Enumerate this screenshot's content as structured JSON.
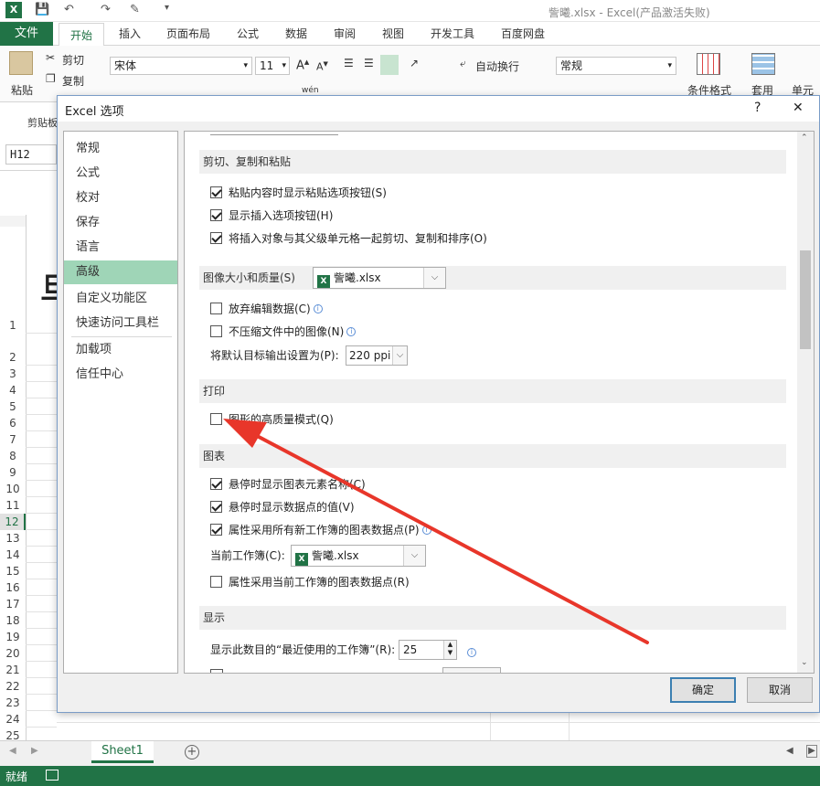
{
  "titlebar": {
    "title": "訾曦.xlsx - Excel(产品激活失败)"
  },
  "ribbon_tabs": {
    "file": "文件",
    "tabs": [
      "开始",
      "插入",
      "页面布局",
      "公式",
      "数据",
      "审阅",
      "视图",
      "开发工具",
      "百度网盘"
    ]
  },
  "ribbon": {
    "paste": "粘贴",
    "cut": "剪切",
    "copy": "复制",
    "clipboard": "剪贴板",
    "font_name": "宋体",
    "font_size": "11",
    "wrap_text": "自动换行",
    "number_format": "常规",
    "cond_format": "条件格式",
    "apply": "套用",
    "cell": "单元格",
    "wen": "wén"
  },
  "namebox": "H12",
  "rows": [
    "1",
    "2",
    "3",
    "4",
    "5",
    "6",
    "7",
    "8",
    "9",
    "10",
    "11",
    "12",
    "13",
    "14",
    "15",
    "16",
    "17",
    "18",
    "19",
    "20",
    "21",
    "22",
    "23",
    "24",
    "25"
  ],
  "sheet_tab": "Sheet1",
  "status": "就绪",
  "dialog": {
    "title": "Excel 选项",
    "help": "?",
    "close": "✕",
    "nav": [
      "常规",
      "公式",
      "校对",
      "保存",
      "语言",
      "高级",
      "自定义功能区",
      "快速访问工具栏",
      "加载项",
      "信任中心"
    ],
    "sections": {
      "cut_copy": "剪切、复制和粘贴",
      "image": "图像大小和质量(S)",
      "print": "打印",
      "chart": "图表",
      "display": "显示"
    },
    "options": {
      "paste_btn": "粘贴内容时显示粘贴选项按钮(S)",
      "insert_btn": "显示插入选项按钮(H)",
      "cut_sort": "将插入对象与其父级单元格一起剪切、复制和排序(O)",
      "discard_edit": "放弃编辑数据(C)",
      "no_compress": "不压缩文件中的图像(N)",
      "default_res": "将默认目标输出设置为(P):",
      "hq_graphics": "图形的高质量模式(Q)",
      "hover_name": "悬停时显示图表元素名称(C)",
      "hover_value": "悬停时显示数据点的值(V)",
      "props_follow_new": "属性采用所有新工作簿的图表数据点(P)",
      "current_wb": "当前工作簿(C):",
      "props_follow_current": "属性采用当前工作簿的图表数据点(R)",
      "recent_count": "显示此数目的“最近使用的工作簿”(R):"
    },
    "image_workbook": "訾曦.xlsx",
    "resolution": "220 ppi",
    "current_workbook": "訾曦.xlsx",
    "recent_value": "25",
    "ok": "确定",
    "cancel": "取消"
  },
  "colors": {
    "excel_green": "#217346",
    "nav_selected": "#9fd5b7",
    "annotation_arrow": "#e8362a"
  }
}
